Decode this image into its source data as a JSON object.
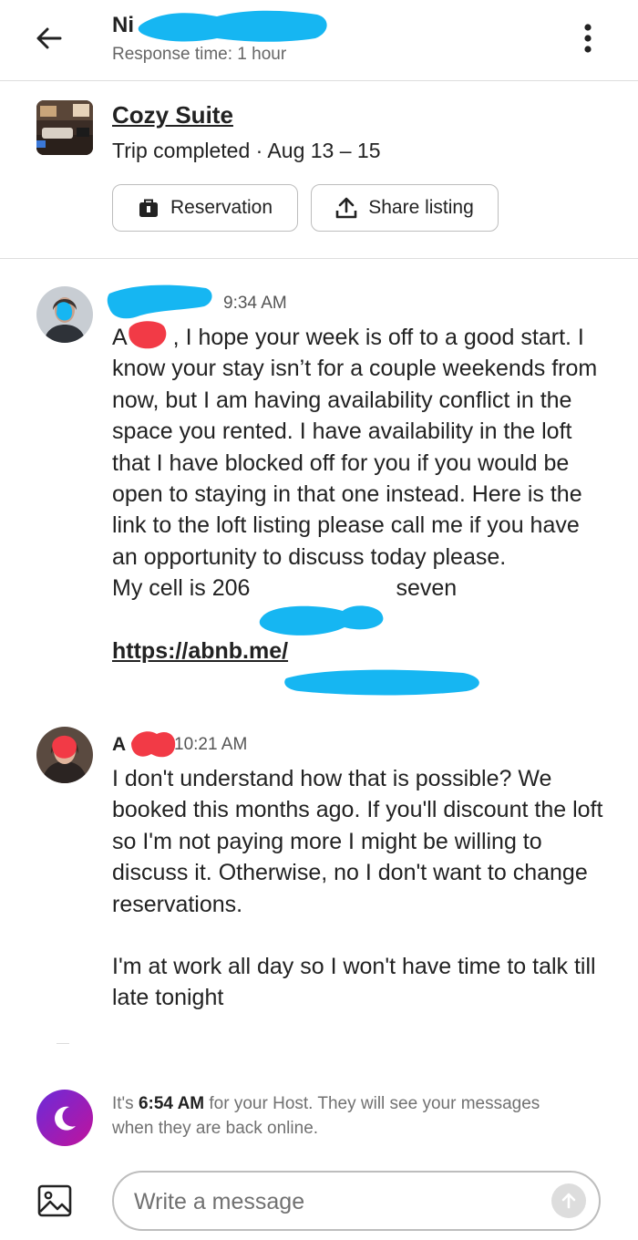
{
  "header": {
    "host_name": "Ni",
    "response_time": "Response time: 1 hour"
  },
  "listing": {
    "title": "Cozy Suite",
    "status": "Trip completed · Aug 13 – 15",
    "reservation_button": "Reservation",
    "share_button": "Share listing"
  },
  "messages": [
    {
      "sender_initial": "",
      "time": "9:34 AM",
      "paragraphs": [
        "A  , I hope your week is off to a good start. I know your stay isn’t for a couple weekends from now, but I am having availability conflict in the space you rented. I have availability in the loft that I have blocked off for you if you would be open to staying in that one instead. Here is the link to the loft listing please call me if you have an opportunity to discuss today please.",
        "My cell is 206",
        "seven"
      ],
      "link": "https://abnb.me/"
    },
    {
      "sender_initial": "A",
      "time": "10:21 AM",
      "paragraphs": [
        "I don't understand how that is possible? We booked this months ago. If you'll discount the loft so I'm not paying more I might be willing to discuss it. Otherwise, no I don't want to change reservations.",
        "I'm at work all day so I won't have time to talk till late tonight"
      ]
    }
  ],
  "host_notice": {
    "prefix": "It's ",
    "time": "6:54 AM",
    "suffix": " for your Host. They will see your messages when they are back online."
  },
  "composer": {
    "placeholder": "Write a message"
  },
  "colors": {
    "redaction_blue": "#16b6f2",
    "redaction_red": "#f23a46",
    "moon_gradient_start": "#6b2bd9",
    "moon_gradient_end": "#c0139c"
  }
}
